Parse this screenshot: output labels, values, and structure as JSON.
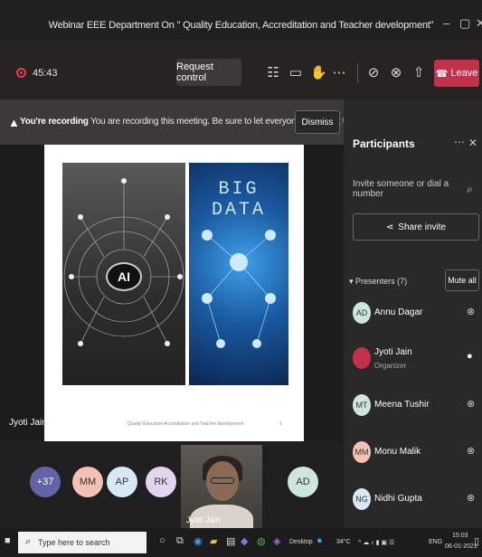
{
  "window": {
    "title": "Webinar EEE Department On \" Quality Education, Accreditation and Teacher development\""
  },
  "toolbar": {
    "timer": "45:43",
    "request_control": "Request control",
    "leave": "Leave"
  },
  "recording": {
    "title": "You're recording",
    "message": "You are recording this meeting. Be sure to let everyone know that they are...",
    "dismiss": "Dismiss"
  },
  "stage": {
    "slide_caption": "Quality Education Accreditation and Teacher development",
    "slide_num": "1",
    "speaker_name": "Jyoti Jain",
    "big_data_text": "BIG DATA",
    "ai_text": "AI"
  },
  "gallery": {
    "avatars": [
      {
        "initials": "+37",
        "color": "#6264a7"
      },
      {
        "initials": "MM",
        "color": "#f4c1b5"
      },
      {
        "initials": "AP",
        "color": "#d6e9f5"
      },
      {
        "initials": "RK",
        "color": "#e3d5f0"
      },
      {
        "initials": "AD",
        "color": "#cde7dd"
      }
    ],
    "video_name": "Jyoti Jain"
  },
  "participants": {
    "title": "Participants",
    "invite_placeholder": "Invite someone or dial a number",
    "share_invite": "Share invite",
    "presenters_label": "Presenters (7)",
    "mute_all": "Mute all",
    "people": [
      {
        "initials": "AD",
        "name": "Annu Dagar",
        "role": "",
        "avatar_color": "#cde7dd"
      },
      {
        "initials": "",
        "name": "Jyoti Jain",
        "role": "Organizer",
        "avatar_color": "#c4314b"
      },
      {
        "initials": "MT",
        "name": "Meena Tushir",
        "role": "",
        "avatar_color": "#cde7dd"
      },
      {
        "initials": "MM",
        "name": "Monu Malik",
        "role": "",
        "avatar_color": "#f4c1b5"
      },
      {
        "initials": "NG",
        "name": "Nidhi Gupta",
        "role": "",
        "avatar_color": "#d6e9f5"
      }
    ]
  },
  "taskbar": {
    "search_placeholder": "Type here to search",
    "desktop": "Desktop",
    "temperature": "34°C",
    "lang": "ENG",
    "time": "15:03",
    "date": "06-01-2021"
  }
}
